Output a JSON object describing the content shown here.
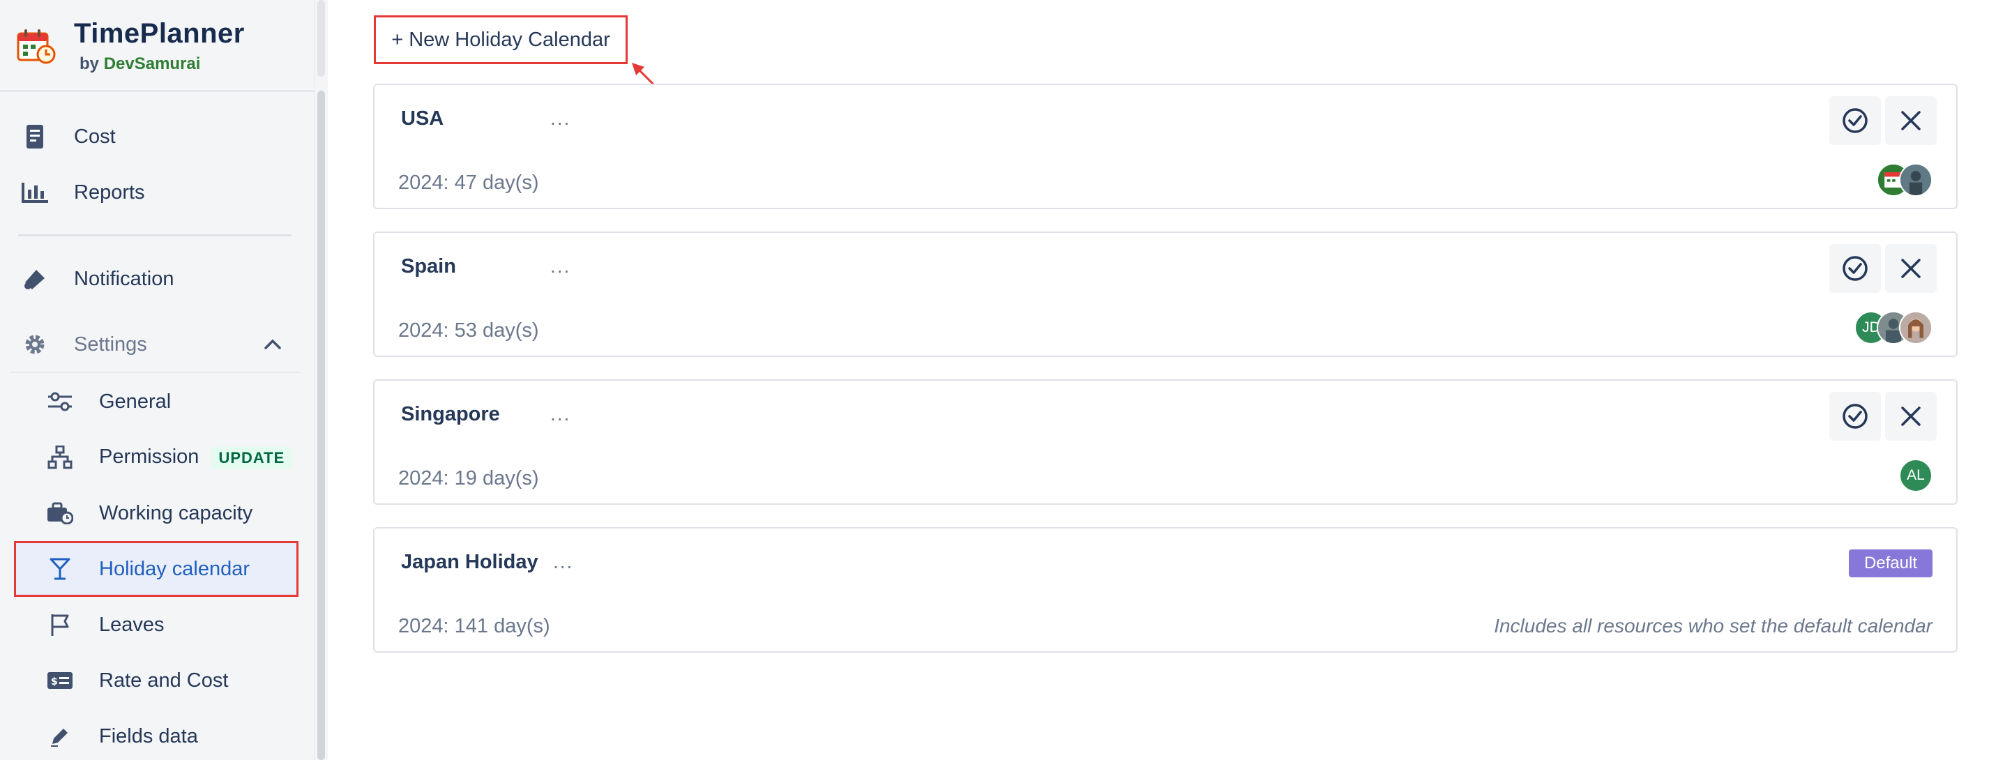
{
  "brand": {
    "name": "TimePlanner",
    "by_prefix": "by",
    "by_company": "DevSamurai"
  },
  "sidebar": {
    "items": [
      {
        "label": "Cost",
        "icon": "receipt-icon"
      },
      {
        "label": "Reports",
        "icon": "bar-chart-icon"
      },
      {
        "label": "Notification",
        "icon": "megaphone-icon"
      },
      {
        "label": "Settings",
        "icon": "gear-icon",
        "expanded": true
      }
    ],
    "settings_items": [
      {
        "label": "General",
        "icon": "sliders-icon"
      },
      {
        "label": "Permission",
        "icon": "hierarchy-icon",
        "badge": "UPDATE"
      },
      {
        "label": "Working capacity",
        "icon": "briefcase-clock-icon"
      },
      {
        "label": "Holiday calendar",
        "icon": "cocktail-glass-icon",
        "active": true
      },
      {
        "label": "Leaves",
        "icon": "flag-icon"
      },
      {
        "label": "Rate and Cost",
        "icon": "money-card-icon"
      },
      {
        "label": "Fields data",
        "icon": "pencil-icon"
      }
    ]
  },
  "main": {
    "new_button_label": "+ New Holiday Calendar",
    "calendars": [
      {
        "name": "USA",
        "menu": "...",
        "count": "2024: 47 day(s)",
        "avatars": [
          {
            "initials": "",
            "color": "#2e7d32"
          },
          {
            "initials": "",
            "color": "#4a6572"
          }
        ]
      },
      {
        "name": "Spain",
        "menu": "...",
        "count": "2024: 53 day(s)",
        "avatars": [
          {
            "initials": "JD",
            "color": "#2e8b57"
          },
          {
            "initials": "",
            "color": "#5d6d7e"
          },
          {
            "initials": "",
            "color": "#a1887f"
          }
        ]
      },
      {
        "name": "Singapore",
        "menu": "...",
        "count": "2024: 19 day(s)",
        "avatars": [
          {
            "initials": "AL",
            "color": "#2e8b57"
          }
        ]
      },
      {
        "name": "Japan Holiday",
        "menu": "...",
        "count": "2024: 141 day(s)",
        "default_badge": "Default",
        "default_note": "Includes all resources who set the default calendar"
      }
    ]
  },
  "colors": {
    "accent": "#1f5fbf",
    "highlight_border": "#e53935",
    "default_badge": "#8777d9",
    "update_badge_bg": "#e3fcef",
    "update_badge_fg": "#006644"
  }
}
